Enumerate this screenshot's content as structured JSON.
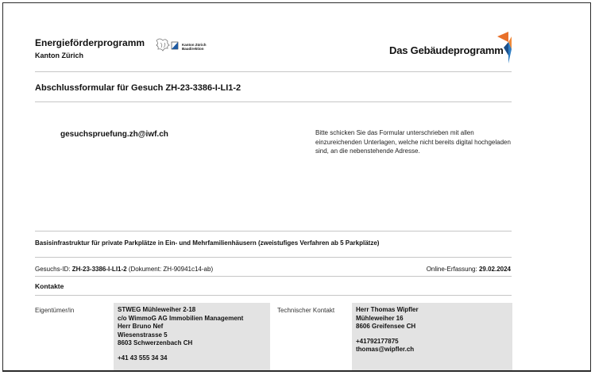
{
  "header": {
    "program_title": "Energieförderprogramm",
    "program_subtitle": "Kanton Zürich",
    "kanton_logo_line1": "Kanton Zürich",
    "kanton_logo_line2": "Baudirektion",
    "brand_name": "Das Gebäudeprogramm",
    "brand_colors": {
      "orange": "#e8702a",
      "blue": "#2f7ec4",
      "dark_blue": "#1a4f8a"
    }
  },
  "form_title": "Abschlussformular für Gesuch ZH-23-3386-I-LI1-2",
  "recipient_email": "gesuchspruefung.zh@iwf.ch",
  "instruction_text": "Bitte schicken Sie das Formular unterschrieben mit allen einzureichenden Unterlagen, welche nicht bereits digital hochgeladen sind, an die nebenstehende Adresse.",
  "section_title": "Basisinfrastruktur für private Parkplätze in Ein- und Mehrfamilienhäusern (zweistufiges Verfahren ab 5 Parkplätze)",
  "gesuch": {
    "id_label": "Gesuchs-ID: ",
    "id_value": "ZH-23-3386-I-LI1-2",
    "document": " (Dokument: ZH-90941c14-ab)",
    "online_label": "Online-Erfassung: ",
    "online_date": "29.02.2024"
  },
  "contacts": {
    "heading": "Kontakte",
    "owner": {
      "label": "Eigentümer/in",
      "lines": [
        "STWEG Mühleweiher 2-18",
        "c/o WimmoG AG Immobilien Management",
        "Herr Bruno Nef",
        "Wiesenstrasse 5",
        "8603 Schwerzenbach CH"
      ],
      "phone": "+41 43 555 34 34"
    },
    "technical": {
      "label": "Technischer Kontakt",
      "lines": [
        "Herr Thomas Wipfler",
        "Mühleweiher 16",
        "8606 Greifensee CH"
      ],
      "phone": "+41792177875",
      "email": "thomas@wipfler.ch"
    }
  }
}
